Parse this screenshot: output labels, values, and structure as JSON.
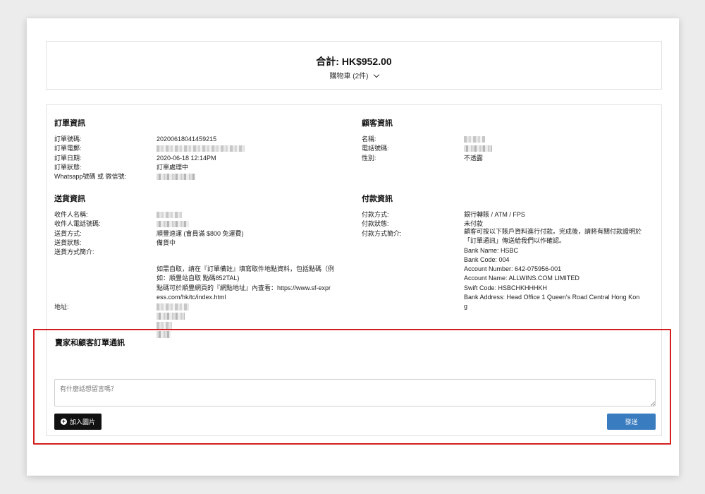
{
  "summary": {
    "total": "合計: HK$952.00",
    "cart": "購物車 (2件)"
  },
  "order_info": {
    "title": "訂單資訊",
    "rows": [
      {
        "label": "訂單號碼:",
        "value": "20200618041459215"
      },
      {
        "label": "訂單電郵:",
        "value": ""
      },
      {
        "label": "訂單日期:",
        "value": "2020-06-18 12:14PM"
      },
      {
        "label": "訂單狀態:",
        "value": "訂單處理中"
      },
      {
        "label": "Whatsapp號碼 或 微信號:",
        "value": ""
      }
    ]
  },
  "customer_info": {
    "title": "顧客資訊",
    "rows": [
      {
        "label": "名稱:",
        "value": ""
      },
      {
        "label": "電話號碼:",
        "value": ""
      },
      {
        "label": "性別:",
        "value": "不透露"
      }
    ]
  },
  "delivery_info": {
    "title": "送貨資訊",
    "rows": [
      {
        "label": "收件人名稱:",
        "value": ""
      },
      {
        "label": "收件人電話號碼:",
        "value": ""
      },
      {
        "label": "送貨方式:",
        "value": "順豐速運 (會員滿 $800 免運費)"
      },
      {
        "label": "送貨狀態:",
        "value": "備貨中"
      },
      {
        "label": "送貨方式簡介:",
        "value": ""
      },
      {
        "label": "地址:",
        "value": ""
      }
    ],
    "description_lines": [
      "如需自取，請在『訂單備註』填寫取件地點資料，包括點碼（例",
      "如：順豐站自取 點碼852TAL)",
      "點碼可於順豐網頁的『網點地址』內查看：https://www.sf-expr",
      "ess.com/hk/tc/index.html"
    ]
  },
  "payment_info": {
    "title": "付款資訊",
    "rows": [
      {
        "label": "付款方式:",
        "value": "銀行轉賬 / ATM / FPS"
      },
      {
        "label": "付款狀態:",
        "value": "未付款"
      },
      {
        "label": "付款方式簡介:",
        "value": ""
      }
    ],
    "description_lines": [
      "顧客可按以下賬戶資料進行付款。完成後，請將有關付款證明於",
      "「訂單通訊」傳送給我們以作確認。",
      "Bank Name: HSBC",
      "Bank Code: 004",
      "Account Number: 642-075956-001",
      "Account Name: ALLWINS.COM LIMITED",
      "Swift Code: HSBCHKHHHKH",
      "Bank Address: Head Office 1 Queen's Road Central Hong Kon",
      "g"
    ]
  },
  "messages": {
    "title": "賣家和顧客訂單通訊",
    "placeholder": "有什麼話想留言嗎？",
    "add_image_label": "加入圖片",
    "send_label": "發送"
  }
}
